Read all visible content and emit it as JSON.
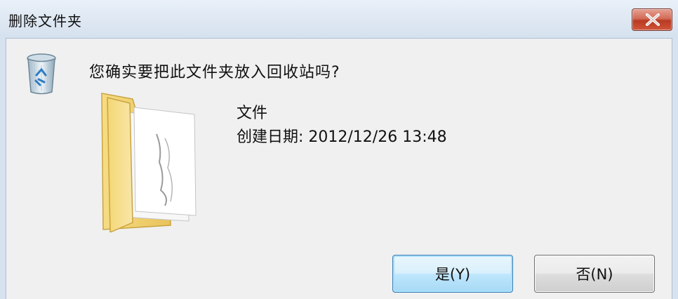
{
  "window": {
    "title": "删除文件夹",
    "close_icon": "close-x-icon"
  },
  "dialog": {
    "question": "您确实要把此文件夹放入回收站吗?",
    "icon": "recycle-bin-icon",
    "item": {
      "icon": "folder-icon",
      "name": "文件",
      "created": "创建日期: 2012/12/26 13:48"
    }
  },
  "buttons": {
    "yes_label": "是(Y)",
    "no_label": "否(N)"
  },
  "colors": {
    "close_button": "#c9482f",
    "default_button_border": "#3c7fb1",
    "folder": "#f3d36b"
  }
}
